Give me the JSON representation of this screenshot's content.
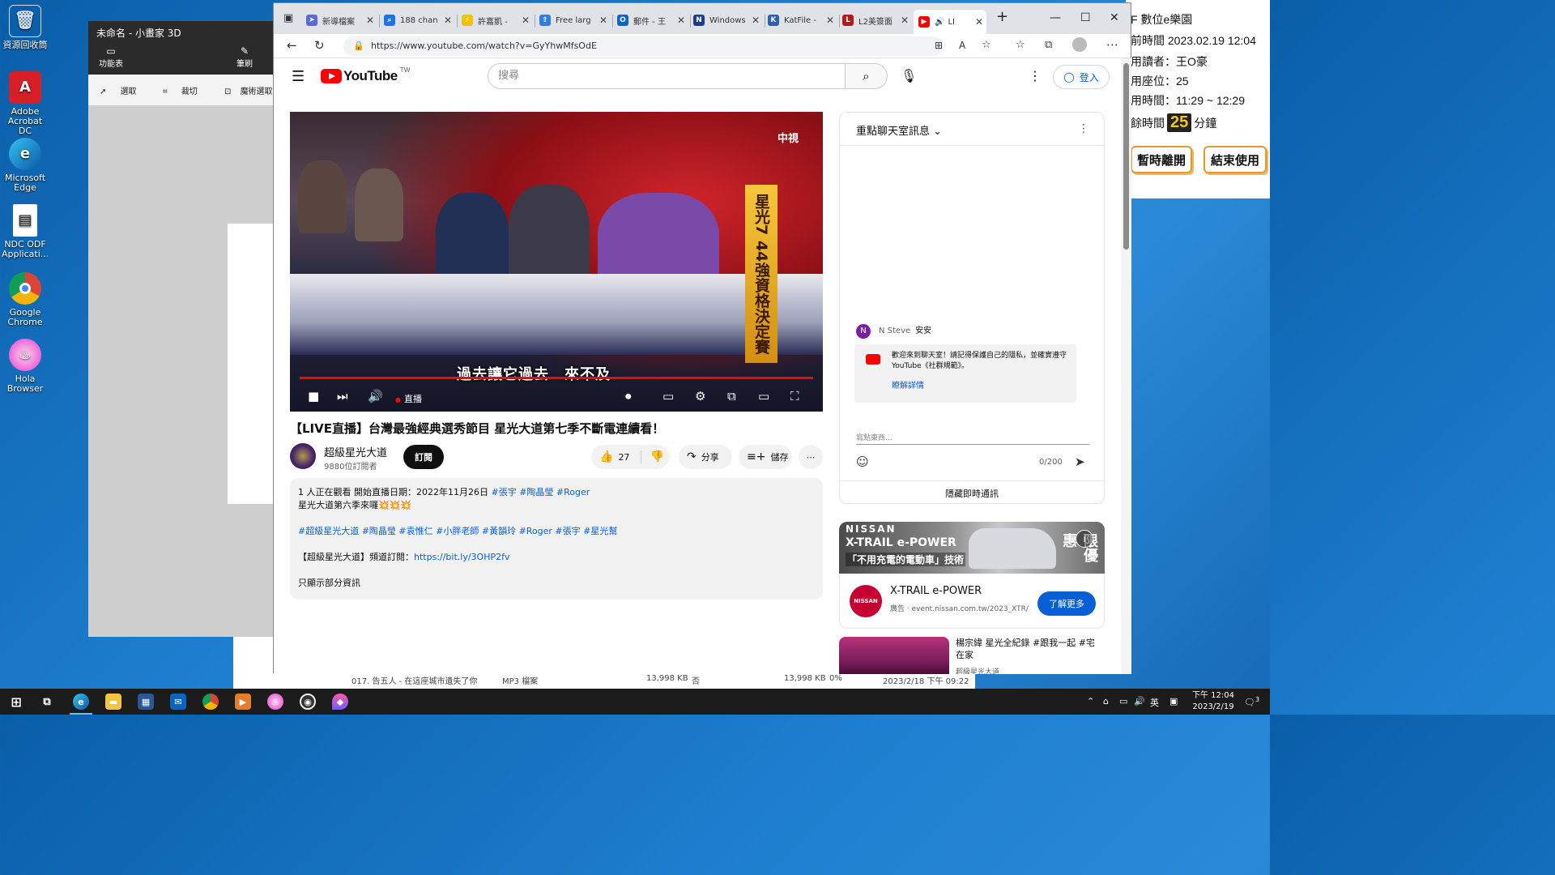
{
  "desktop": {
    "icons": [
      {
        "label": "資源回收筒",
        "icon": "recycle-bin-icon"
      },
      {
        "label": "Adobe Acrobat DC",
        "icon": "acrobat-icon"
      },
      {
        "label": "Microsoft Edge",
        "icon": "edge-icon"
      },
      {
        "label": "NDC ODF Applicati...",
        "icon": "odf-icon"
      },
      {
        "label": "Google Chrome",
        "icon": "chrome-icon"
      },
      {
        "label": "Hola Browser",
        "icon": "hola-icon"
      }
    ]
  },
  "info_panel": {
    "title": "F 數位e樂園",
    "current_time": "前時間 2023.02.19 12:04",
    "reader": "用讀者：王O豪",
    "seat": "用座位：25",
    "period": "用時間：11:29 ~ 12:29",
    "remaining_prefix": "餘時間",
    "remaining_value": "25",
    "remaining_unit": "分鐘",
    "pause_button": "暫時離開",
    "end_button": "結束使用"
  },
  "paint3d": {
    "title": "未命名 - 小畫家 3D",
    "menu_label": "功能表",
    "brush_label": "筆刷",
    "tools": [
      "選取",
      "裁切",
      "魔術選取"
    ]
  },
  "explorer": {
    "file_name": "017. 告五人 - 在這座城市遺失了你",
    "file_type": "MP3 檔案",
    "size1": "13,998 KB",
    "flag": "否",
    "size2": "13,998 KB",
    "ratio": "0%",
    "date": "2023/2/18 下午 09:22"
  },
  "browser": {
    "tabs": [
      {
        "label": "新導檔案",
        "color": "#5b6bd6",
        "icon": "send-icon"
      },
      {
        "label": "188 chan",
        "color": "#1a73e8",
        "icon": "search-icon"
      },
      {
        "label": "許嘉凱 -",
        "color": "#f2c200",
        "icon": "bolt-icon"
      },
      {
        "label": "Free larg",
        "color": "#2f7de1",
        "icon": "upload-icon"
      },
      {
        "label": "郵件 - 王",
        "color": "#0a64c0",
        "icon": "outlook-icon"
      },
      {
        "label": "Windows",
        "color": "#1c3d8a",
        "icon": "windows-news-icon"
      },
      {
        "label": "KatFile -",
        "color": "#2b5fb0",
        "icon": "katfile-icon"
      },
      {
        "label": "L2美簽面",
        "color": "#b01c1c",
        "icon": "l2-icon"
      },
      {
        "label": "LI",
        "color": "#ff0000",
        "icon": "youtube-icon"
      }
    ],
    "new_tab": "+",
    "url": "https://www.youtube.com/watch?v=GyYhwMfsOdE"
  },
  "youtube": {
    "logo_text": "YouTube",
    "country": "TW",
    "search_placeholder": "搜尋",
    "signin": "登入",
    "player": {
      "channel_logo": "中視",
      "banner": "星光7 44強資格決定賽",
      "subtitle": "過去讓它過去　來不及",
      "live_label": "直播"
    },
    "video_title": "【LIVE直播】台灣最強經典選秀節目 星光大道第七季不斷電連續看！",
    "channel_name": "超級星光大道",
    "subscribers": "9880位訂閱者",
    "subscribe": "訂閱",
    "likes": "27",
    "share": "分享",
    "save": "儲存",
    "description": {
      "line1_prefix": "1 人正在觀看  開始直播日期：2022年11月26日 ",
      "line1_tags": "#張宇 #陶晶瑩 #Roger",
      "line2": "星光大道第六季來囉💥💥💥",
      "line3_tags": "#超級星光大道 #陶晶瑩 #袁惟仁 #小胖老師 #黃韻玲 #Roger #張宇 #星光幫",
      "line4_prefix": "【超級星光大道】頻道訂閱：",
      "line4_link": "https://bit.ly/3OHP2fv",
      "more": "只顯示部分資訊"
    },
    "chat": {
      "header": "重點聊天室訊息",
      "msg_author": "N Steve",
      "msg_avatar": "N",
      "msg_text": "安安",
      "notice": "歡迎來到聊天室！請記得保護自己的隱私，並確實遵守 YouTube《社群規範》。",
      "notice_link": "瞭解詳情",
      "input_placeholder": "寫點東西...",
      "counter": "0/200",
      "hide": "隱藏即時通訊"
    },
    "ad": {
      "brand": "NISSAN",
      "model": "X-TRAIL e-POWER",
      "slogan": "「不用充電的電動車」技術",
      "promo": "限優惠",
      "logo": "NISSAN",
      "title": "X-TRAIL e-POWER",
      "sub": "廣告 · event.nissan.com.tw/2023_XTR/",
      "cta": "了解更多"
    },
    "recommendation": {
      "title": "楊宗緯 星光全紀錄 #跟我一起 #宅在家",
      "channel": "超級星光大道"
    }
  },
  "taskbar": {
    "tray_lang": "英",
    "time": "下午 12:04",
    "date": "2023/2/19",
    "notify": "3"
  }
}
